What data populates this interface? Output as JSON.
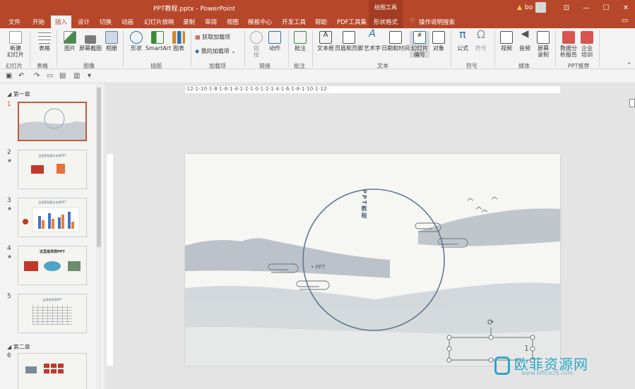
{
  "title": {
    "text": "PPT教程.pptx  -  PowerPoint",
    "context_tool": "绘图工具",
    "user": "bo"
  },
  "window_controls": {
    "restore": "⊡",
    "minimize": "—",
    "maximize": "☐",
    "close": "✕"
  },
  "tabs": [
    "文件",
    "开始",
    "插入",
    "设计",
    "切换",
    "动画",
    "幻灯片放映",
    "录制",
    "审阅",
    "视图",
    "模板中心",
    "开发工具",
    "帮助",
    "PDF工具集",
    "形状格式",
    "操作说明搜索"
  ],
  "ribbon": {
    "buttons": [
      {
        "label": "新建\n幻灯片",
        "icon": "new-slide-icon"
      },
      {
        "label": "表格",
        "icon": "table-icon"
      },
      {
        "label": "图片",
        "icon": "picture-icon"
      },
      {
        "label": "屏幕截图",
        "icon": "screenshot-icon"
      },
      {
        "label": "相册",
        "icon": "album-icon"
      },
      {
        "label": "形状",
        "icon": "shapes-icon"
      },
      {
        "label": "SmartArt",
        "icon": "smartart-icon"
      },
      {
        "label": "图表",
        "icon": "chart-icon"
      },
      {
        "label": "获取加载项",
        "icon": "store-icon"
      },
      {
        "label": "我的加载项",
        "icon": "addins-icon"
      },
      {
        "label": "链\n接",
        "icon": "link-icon"
      },
      {
        "label": "动作",
        "icon": "action-icon"
      },
      {
        "label": "批注",
        "icon": "comment-icon"
      },
      {
        "label": "文本框",
        "icon": "textbox-icon"
      },
      {
        "label": "页眉和页脚",
        "icon": "header-footer-icon"
      },
      {
        "label": "艺术字",
        "icon": "wordart-icon"
      },
      {
        "label": "日期和时间",
        "icon": "datetime-icon"
      },
      {
        "label": "幻灯片\n编号",
        "icon": "slide-number-icon"
      },
      {
        "label": "对象",
        "icon": "object-icon"
      },
      {
        "label": "公式",
        "icon": "equation-icon"
      },
      {
        "label": "符号",
        "icon": "symbol-icon"
      },
      {
        "label": "视频",
        "icon": "video-icon"
      },
      {
        "label": "音频",
        "icon": "audio-icon"
      },
      {
        "label": "屏幕\n录制",
        "icon": "screen-record-icon"
      },
      {
        "label": "数据分\n析报告",
        "icon": "data-report-icon"
      },
      {
        "label": "企业\n培训",
        "icon": "training-icon"
      }
    ],
    "groups": [
      "幻灯片",
      "表格",
      "图像",
      "插图",
      "加载项",
      "链接",
      "批注",
      "文本",
      "符号",
      "媒体",
      "PPT推荐"
    ]
  },
  "outline": {
    "sections": [
      "第一章",
      "第二章"
    ],
    "slides": [
      {
        "num": "1",
        "starred": false,
        "title": "",
        "selected": true
      },
      {
        "num": "2",
        "starred": true,
        "title": "这里是标题文本框PPT",
        "selected": false
      },
      {
        "num": "3",
        "starred": true,
        "title": "这里是标题文本框PPT",
        "selected": false
      },
      {
        "num": "4",
        "starred": true,
        "title": "这里是举例PPT",
        "selected": false
      },
      {
        "num": "5",
        "starred": false,
        "title": "这里是举例PPT",
        "selected": false
      },
      {
        "num": "6",
        "starred": false,
        "title": "",
        "selected": false
      }
    ]
  },
  "ruler": {
    "h": "·12·1·10·1·8·1·6·1·4·1·2·1·0·1·2·1·4·1·6·1·8·1·10·1·12·"
  },
  "slide": {
    "vertical_title": "PPT教程",
    "subtitle": "• PPT",
    "page_number": "1"
  },
  "watermark": {
    "text": "欧菲资源网",
    "url": "www.office26.com"
  },
  "colors": {
    "brand": "#b7472a",
    "ink": "#5a6e82"
  }
}
